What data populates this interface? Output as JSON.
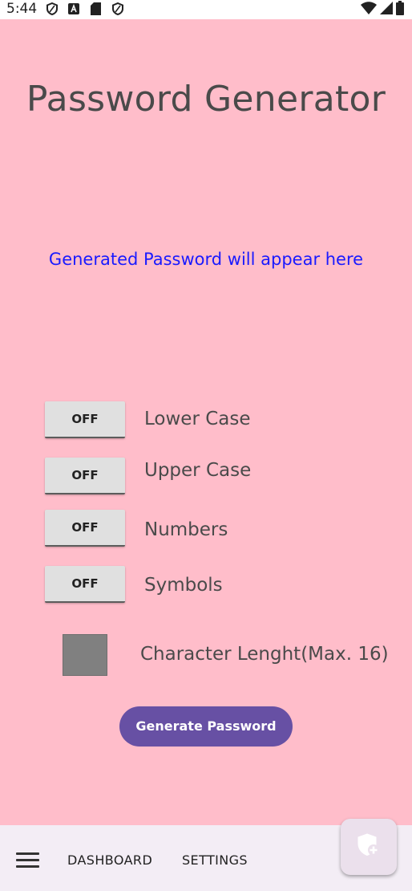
{
  "status_bar": {
    "time": "5:44",
    "icons": [
      "shield-icon",
      "text-a-icon",
      "sd-card-icon",
      "shield-icon",
      "wifi-icon",
      "signal-icon",
      "battery-icon"
    ]
  },
  "app": {
    "title": "Password Generator",
    "password_placeholder": "Generated Password will appear here",
    "background_color": "#ffbdca",
    "accent_color": "#6750a4",
    "output_color": "#1a1aff"
  },
  "options": [
    {
      "state": "OFF",
      "label": "Lower Case"
    },
    {
      "state": "OFF",
      "label": "Upper Case"
    },
    {
      "state": "OFF",
      "label": "Numbers"
    },
    {
      "state": "OFF",
      "label": "Symbols"
    }
  ],
  "length": {
    "label": "Character Lenght(Max. 16)",
    "value": ""
  },
  "generate_button": "Generate Password",
  "bottom_bar": {
    "items": [
      "DASHBOARD",
      "SETTINGS"
    ],
    "menu_icon": "hamburger-menu-icon",
    "fab_icon": "shield-add-icon"
  }
}
